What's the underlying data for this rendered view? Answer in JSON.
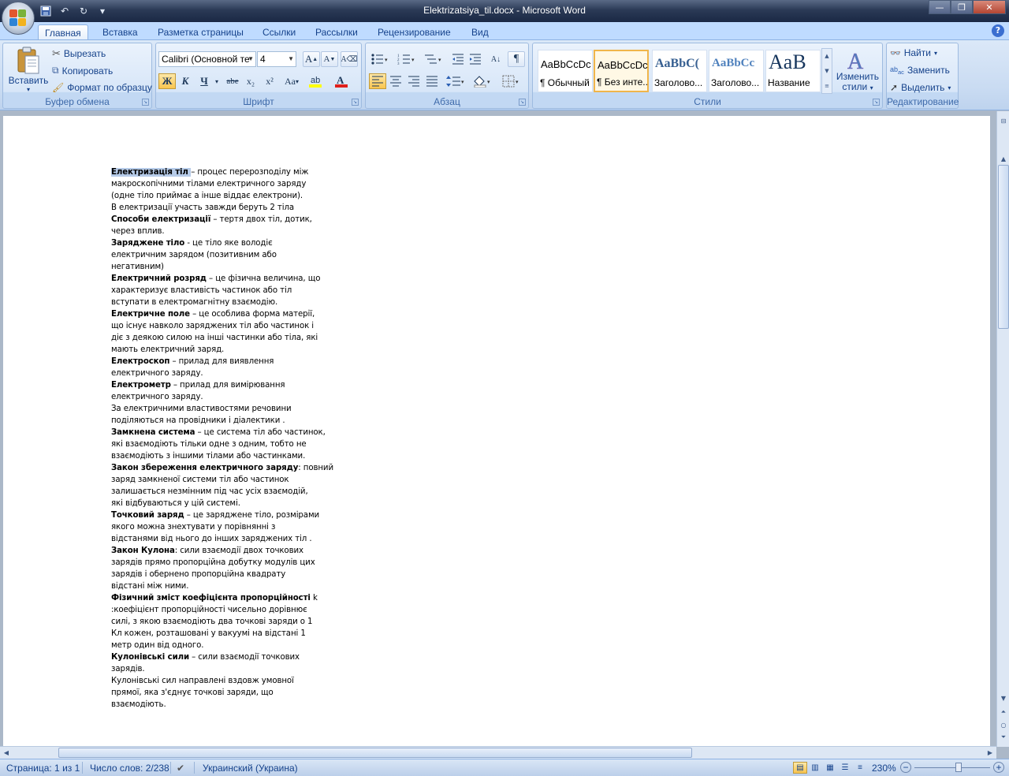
{
  "window": {
    "title": "Elektrizatsiya_til.docx - Microsoft Word"
  },
  "tabs": [
    {
      "label": "Главная"
    },
    {
      "label": "Вставка"
    },
    {
      "label": "Разметка страницы"
    },
    {
      "label": "Ссылки"
    },
    {
      "label": "Рассылки"
    },
    {
      "label": "Рецензирование"
    },
    {
      "label": "Вид"
    }
  ],
  "clipboard": {
    "paste": "Вставить",
    "cut": "Вырезать",
    "copy": "Копировать",
    "format_painter": "Формат по образцу",
    "label": "Буфер обмена"
  },
  "font": {
    "name": "Calibri (Основной те",
    "size": "4",
    "label": "Шрифт",
    "bold": "Ж",
    "italic": "К",
    "underline": "Ч",
    "strike": "abe",
    "subscript": "x₂",
    "superscript": "x²",
    "case": "Aa",
    "grow": "A",
    "shrink": "A"
  },
  "paragraph": {
    "label": "Абзац",
    "pilcrow": "¶"
  },
  "styles": {
    "label": "Стили",
    "tiles": [
      {
        "sample": "AaBbCcDc",
        "name": "¶ Обычный"
      },
      {
        "sample": "AaBbCcDc",
        "name": "¶ Без инте..."
      },
      {
        "sample": "AaBbC(",
        "name": "Заголово..."
      },
      {
        "sample": "AaBbCc",
        "name": "Заголово..."
      },
      {
        "sample": "AaB",
        "name": "Название"
      }
    ],
    "change_line1": "Изменить",
    "change_line2": "стили"
  },
  "editing": {
    "label": "Редактирование",
    "find": "Найти",
    "replace": "Заменить",
    "select": "Выделить"
  },
  "document": {
    "lines": [
      [
        {
          "b": true,
          "hl": true,
          "t": "Електризація тіл "
        },
        {
          "t": "– процес перерозподілу  між"
        }
      ],
      [
        {
          "t": "макроскопічними тілами електричного заряду"
        }
      ],
      [
        {
          "t": "(одне тіло приймає а інше віддає електрони)."
        }
      ],
      [
        {
          "t": "В електризації участь завжди беруть  2 тіла"
        }
      ],
      [
        {
          "b": true,
          "t": "Способи  електризації"
        },
        {
          "t": " – тертя  двох тіл, дотик,"
        }
      ],
      [
        {
          "t": "через вплив."
        }
      ],
      [
        {
          "b": true,
          "t": "Заряджене тіло"
        },
        {
          "t": "  - це тіло яке володіє"
        }
      ],
      [
        {
          "t": "електричним зарядом (позитивним або"
        }
      ],
      [
        {
          "t": "негативним)"
        }
      ],
      [
        {
          "b": true,
          "t": "Електричний розряд"
        },
        {
          "t": "  – це фізична величина, що"
        }
      ],
      [
        {
          "t": "характеризує властивість частинок або тіл"
        }
      ],
      [
        {
          "t": "вступати в електромагнітну  взаємодію."
        }
      ],
      [
        {
          "b": true,
          "t": "Електричне поле"
        },
        {
          "t": " – це особлива  форма матерії,"
        }
      ],
      [
        {
          "t": "що існує  навколо заряджених тіл або частинок і"
        }
      ],
      [
        {
          "t": "діє з деякою силою  на інші частинки або тіла, які"
        }
      ],
      [
        {
          "t": "мають електричний заряд."
        }
      ],
      [
        {
          "b": true,
          "t": "Електроскоп"
        },
        {
          "t": "  – прилад для виявлення"
        }
      ],
      [
        {
          "t": "електричного заряду."
        }
      ],
      [
        {
          "b": true,
          "t": "Електрометр"
        },
        {
          "t": " – прилад для вимірювання"
        }
      ],
      [
        {
          "t": "електричного заряду."
        }
      ],
      [
        {
          "t": "За електричними властивостями речовини"
        }
      ],
      [
        {
          "t": "поділяються на провідники і діалектики ."
        }
      ],
      [
        {
          "b": true,
          "t": "Замкнена система"
        },
        {
          "t": " – це система тіл або частинок,"
        }
      ],
      [
        {
          "t": "які взаємодіють тільки одне з одним, тобто не"
        }
      ],
      [
        {
          "t": "взаємодіють з іншими тілами або частинками."
        }
      ],
      [
        {
          "b": true,
          "t": "Закон збереження  електричного  заряду"
        },
        {
          "t": ": повний"
        }
      ],
      [
        {
          "t": "заряд замкненої системи тіл або частинок"
        }
      ],
      [
        {
          "t": "залишається незмінним під час усіх взаємодій,"
        }
      ],
      [
        {
          "t": "які відбуваються у цій системі."
        }
      ],
      [
        {
          "b": true,
          "t": "Точковий заряд"
        },
        {
          "t": " – це заряджене тіло, розмірами"
        }
      ],
      [
        {
          "t": "якого можна  знехтувати у порівнянні  з"
        }
      ],
      [
        {
          "t": "відстанями від нього до інших заряджених тіл ."
        }
      ],
      [
        {
          "b": true,
          "t": "Закон Кулона"
        },
        {
          "t": ": сили взаємодії двох точкових"
        }
      ],
      [
        {
          "t": "зарядів прямо пропорційна  добутку модулів цих"
        }
      ],
      [
        {
          "t": "зарядів і обернено  пропорційна  квадрату"
        }
      ],
      [
        {
          "t": "відстані між ними."
        }
      ],
      [
        {
          "b": true,
          "t": "Фізичний зміст коефіцієнта  пропорційності"
        },
        {
          "t": "    k"
        }
      ],
      [
        {
          "t": ":коефіцієнт пропорційності  чисельно дорівнює"
        }
      ],
      [
        {
          "t": "силі, з якою взаємодіють два точкові заряди о 1"
        }
      ],
      [
        {
          "t": "Кл кожен,  розташовані  у вакуумі  на відстані 1"
        }
      ],
      [
        {
          "t": "метр один  від одного."
        }
      ],
      [
        {
          "b": true,
          "t": "Кулонівські сили"
        },
        {
          "t": " – сили взаємодії точкових"
        }
      ],
      [
        {
          "t": "зарядів."
        }
      ],
      [
        {
          "t": "Кулонівські сил направлені  вздовж умовної"
        }
      ],
      [
        {
          "t": "прямої, яка з'єднує  точкові заряди, що"
        }
      ],
      [
        {
          "t": "взаємодіють."
        }
      ]
    ]
  },
  "status": {
    "page": "Страница: 1 из 1",
    "words": "Число слов: 2/238",
    "language": "Украинский (Украина)",
    "zoom": "230%",
    "zoom_level": 0.58
  },
  "colors": {
    "ribbon_text": "#15428b",
    "selection": "#b6cbe8",
    "title_bar": "#2b3a56"
  }
}
